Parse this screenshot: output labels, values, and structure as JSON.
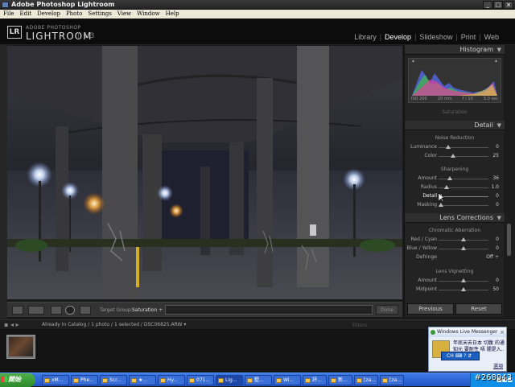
{
  "window": {
    "title": "Adobe Photoshop Lightroom",
    "buttons": [
      "_",
      "□",
      "×"
    ]
  },
  "menu": [
    "File",
    "Edit",
    "Develop",
    "Photo",
    "Settings",
    "View",
    "Window",
    "Help"
  ],
  "identity": {
    "logo": "LR",
    "brand_small": "ADOBE PHOTOSHOP",
    "brand_big": "LIGHTROOM",
    "version": "1.3"
  },
  "modules": {
    "library": "Library",
    "develop": "Develop",
    "slideshow": "Slideshow",
    "print": "Print",
    "web": "Web",
    "sep": "|"
  },
  "histogram": {
    "title": "Histogram",
    "iso": "ISO 200",
    "focal": "20 mm",
    "aperture": "f / 10",
    "shutter": "5.0 sec",
    "curtain": "Saturation"
  },
  "detail": {
    "title": "Detail",
    "noise": {
      "heading": "Noise Reduction",
      "luminance": "Luminance",
      "luminance_val": "0",
      "color": "Color",
      "color_val": "25"
    },
    "sharpening": {
      "heading": "Sharpening",
      "amount": "Amount",
      "amount_val": "36",
      "radius": "Radius",
      "radius_val": "1.0",
      "detail": "Detail",
      "detail_val": "0",
      "masking": "Masking",
      "masking_val": "0"
    }
  },
  "lens": {
    "title": "Lens Corrections",
    "ca": {
      "heading": "Chromatic Aberration",
      "redcyan": "Red / Cyan",
      "redcyan_val": "0",
      "blueyellow": "Blue / Yellow",
      "blueyellow_val": "0",
      "defringe": "Defringe",
      "defringe_val": "Off ÷"
    },
    "vig": {
      "heading": "Lens Vignetting",
      "amount": "Amount",
      "amount_val": "0",
      "midpoint": "Midpoint",
      "midpoint_val": "50"
    }
  },
  "toolbar": {
    "target_label": "Target Group:",
    "target_value": "Saturation ÷",
    "done": "Done"
  },
  "buttons": {
    "previous": "Previous",
    "reset": "Reset"
  },
  "filmstrip": {
    "nav": "▪ ◂ ▸",
    "path": "Already In Catalog / 1 photo / 1 selected / DSC06825.ARW ▾",
    "filters": "Filters"
  },
  "messenger": {
    "title": "Windows Live Messenger",
    "close": "×",
    "message": "年底宋去日本 切腹 的通知元 要耐性 唔 闇是入..",
    "options": "選項"
  },
  "ime": {
    "text": "CH ⌨ ? ⇵"
  },
  "taskbar": {
    "start": "開始",
    "tasks": [
      "xM...",
      "Phe...",
      "Scr...",
      "★...",
      "Hy...",
      "071...",
      "Lig...",
      "墅...",
      "Wi...",
      "評...",
      "新...",
      "[za...",
      "[za..."
    ],
    "tray": "■■■"
  },
  "watermark": "#268943",
  "colors": {
    "accent": "#2254c4",
    "panel": "#232323",
    "photo_bg": "#2a2d33"
  }
}
